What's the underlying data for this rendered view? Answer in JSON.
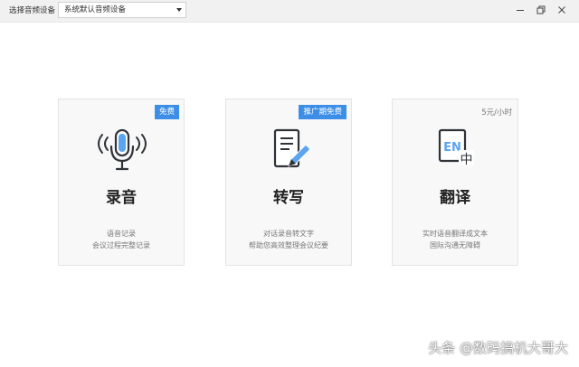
{
  "titlebar": {
    "device_label": "选择音频设备",
    "device_select": {
      "value": "系统默认音频设备"
    },
    "controls": {
      "minimize": "minimize-icon",
      "maximize": "restore-icon",
      "close": "close-icon"
    }
  },
  "cards": [
    {
      "id": "record",
      "badge": "免费",
      "title": "录音",
      "desc_line1": "语音记录",
      "desc_line2": "会议过程完整记录",
      "icon": "microphone-icon"
    },
    {
      "id": "transcribe",
      "badge": "推广期免费",
      "title": "转写",
      "desc_line1": "对话录音转文字",
      "desc_line2": "帮助您高效整理会议纪要",
      "icon": "document-pen-icon"
    },
    {
      "id": "translate",
      "price": "5元/小时",
      "title": "翻译",
      "desc_line1": "实时语音翻译成文本",
      "desc_line2": "国际沟通无障碍",
      "icon": "en-zh-translate-icon",
      "icon_text_en": "EN",
      "icon_text_zh": "中"
    }
  ],
  "colors": {
    "accent": "#3d8ee6",
    "titlebar": "#f1f1f1",
    "card_bg": "#f8f8f8",
    "icon_dark": "#2f3338"
  },
  "watermark": "头条 @数码搞机大哥大"
}
